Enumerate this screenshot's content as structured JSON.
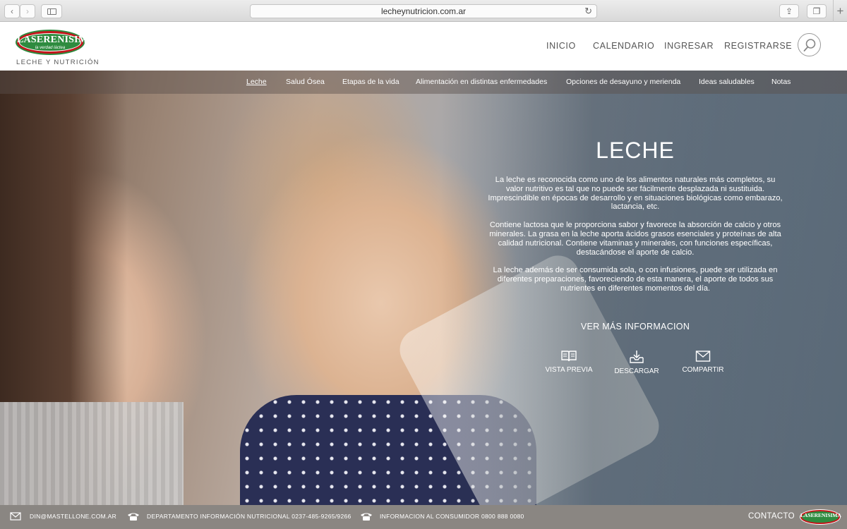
{
  "browser": {
    "url": "lecheynutricion.com.ar",
    "back_glyph": "‹",
    "forward_glyph": "›",
    "reload_glyph": "↻",
    "share_glyph": "⇪",
    "tabs_glyph": "❐",
    "new_tab_glyph": "+"
  },
  "header": {
    "logo_brand": "LASERENISIMA",
    "logo_tagline": "la verdad láctea",
    "site_subtitle": "LECHE Y NUTRICIÓN",
    "nav": {
      "inicio": "INICIO",
      "calendario": "CALENDARIO",
      "ingresar": "INGRESAR",
      "registrarse": "REGISTRARSE"
    }
  },
  "subnav": {
    "leche": "Leche",
    "salud_osea": "Salud Ósea",
    "etapas": "Etapas de la vida",
    "enfermedades": "Alimentación en distintas enfermedades",
    "desayuno": "Opciones de desayuno y merienda",
    "ideas": "Ideas saludables",
    "notas": "Notas"
  },
  "hero": {
    "title": "LECHE",
    "paragraph_1": "La leche es reconocida como uno de los alimentos naturales más completos, su valor nutritivo es tal que no puede ser fácilmente desplazada ni sustituida. Imprescindible en épocas de desarrollo y en situaciones biológicas como embarazo, lactancia, etc.",
    "paragraph_2": "Contiene lactosa que le proporciona sabor y favorece la absorción de calcio y otros minerales. La grasa en la leche aporta ácidos grasos esenciales y proteínas de alta calidad nutricional. Contiene vitaminas y minerales, con funciones específicas, destacándose el aporte de calcio.",
    "paragraph_3": "La leche además de ser consumida sola, o con infusiones, puede ser utilizada en diferentes preparaciones, favoreciendo de esta manera, el aporte de todos sus nutrientes en diferentes momentos del día.",
    "more_info": "VER MÁS INFORMACION",
    "actions": {
      "preview": "VISTA PREVIA",
      "download": "DESCARGAR",
      "share": "COMPARTIR"
    }
  },
  "footer": {
    "email": "DIN@MASTELLONE.COM.AR",
    "department": "DEPARTAMENTO INFORMACIÓN NUTRICIONAL 0237-485-9265/9266",
    "consumer": "INFORMACION AL CONSUMIDOR 0800 888 0080",
    "contact": "CONTACTO",
    "logo_brand": "LASERENISIMA"
  }
}
